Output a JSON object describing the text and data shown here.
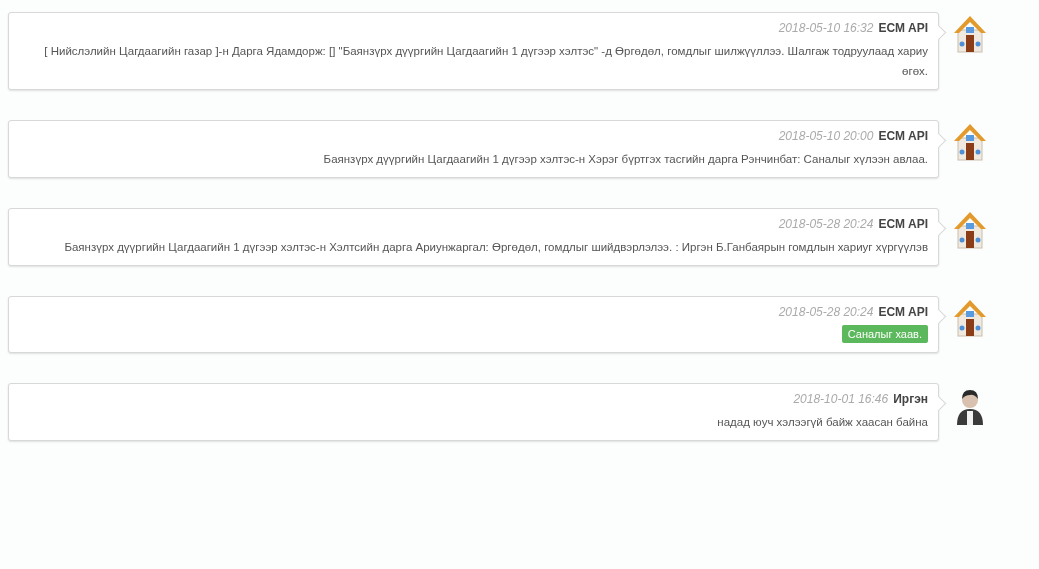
{
  "messages": [
    {
      "avatar": {
        "kind": "house"
      },
      "time": "2018-05-10 16:32",
      "author": "ECM API",
      "kind": "text",
      "body": "[ Нийслэлийн Цагдаагийн газар ]-н Дарга Ядамдорж: [] \"Баянзүрх дүүргийн Цагдаагийн 1 дүгээр хэлтэс\" -д Өргөдөл, гомдлыг шилжүүллээ. Шалгаж тодруулаад хариу өгөх."
    },
    {
      "avatar": {
        "kind": "house"
      },
      "time": "2018-05-10 20:00",
      "author": "ECM API",
      "kind": "text",
      "body": "Баянзүрх дүүргийн Цагдаагийн 1 дүгээр хэлтэс-н Хэрэг бүртгэх тасгийн дарга Рэнчинбат: Саналыг хүлээн авлаа."
    },
    {
      "avatar": {
        "kind": "house"
      },
      "time": "2018-05-28 20:24",
      "author": "ECM API",
      "kind": "text",
      "body": "Баянзүрх дүүргийн Цагдаагийн 1 дүгээр хэлтэс-н Хэлтсийн дарга Ариунжаргал: Өргөдөл, гомдлыг шийдвэрлэлээ. : Иргэн Б.Ганбаярын гомдлын хариуг хүргүүлэв"
    },
    {
      "avatar": {
        "kind": "house"
      },
      "time": "2018-05-28 20:24",
      "author": "ECM API",
      "kind": "label",
      "body": "Саналыг хаав."
    },
    {
      "avatar": {
        "kind": "person"
      },
      "time": "2018-10-01 16:46",
      "author": "Иргэн",
      "kind": "text",
      "body": "надад юуч хэлээгүй байж хаасан байна"
    }
  ]
}
